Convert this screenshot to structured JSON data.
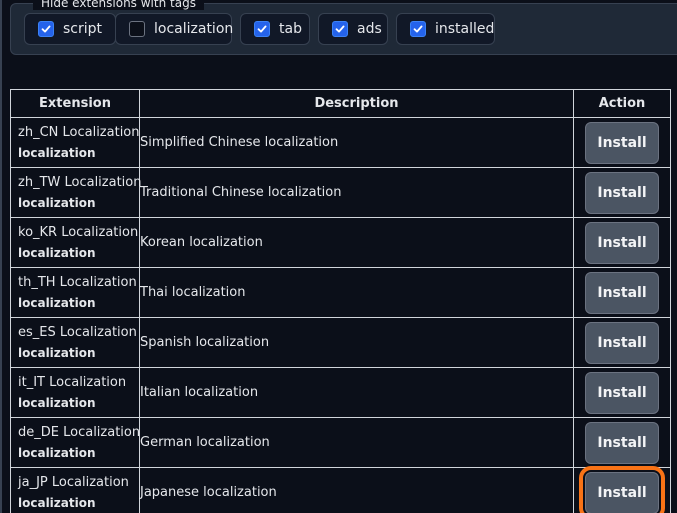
{
  "filter": {
    "legend": "Hide extensions with tags",
    "tags": [
      {
        "label": "script",
        "checked": true
      },
      {
        "label": "localization",
        "checked": false
      },
      {
        "label": "tab",
        "checked": true
      },
      {
        "label": "ads",
        "checked": true
      },
      {
        "label": "installed",
        "checked": true
      }
    ]
  },
  "table": {
    "headers": {
      "extension": "Extension",
      "description": "Description",
      "action": "Action"
    },
    "rows": [
      {
        "name": "zh_CN Localization",
        "tag": "localization",
        "description": "Simplified Chinese localization",
        "action": "Install"
      },
      {
        "name": "zh_TW Localization",
        "tag": "localization",
        "description": "Traditional Chinese localization",
        "action": "Install"
      },
      {
        "name": "ko_KR Localization",
        "tag": "localization",
        "description": "Korean localization",
        "action": "Install"
      },
      {
        "name": "th_TH Localization",
        "tag": "localization",
        "description": "Thai localization",
        "action": "Install"
      },
      {
        "name": "es_ES Localization",
        "tag": "localization",
        "description": "Spanish localization",
        "action": "Install"
      },
      {
        "name": "it_IT Localization",
        "tag": "localization",
        "description": "Italian localization",
        "action": "Install"
      },
      {
        "name": "de_DE Localization",
        "tag": "localization",
        "description": "German localization",
        "action": "Install"
      },
      {
        "name": "ja_JP Localization",
        "tag": "localization",
        "description": "Japanese localization",
        "action": "Install",
        "highlighted": true
      }
    ]
  },
  "colors": {
    "background": "#0b0f19",
    "checkbox_on": "#2563eb",
    "button": "#4b5563",
    "highlight": "#f97316"
  }
}
